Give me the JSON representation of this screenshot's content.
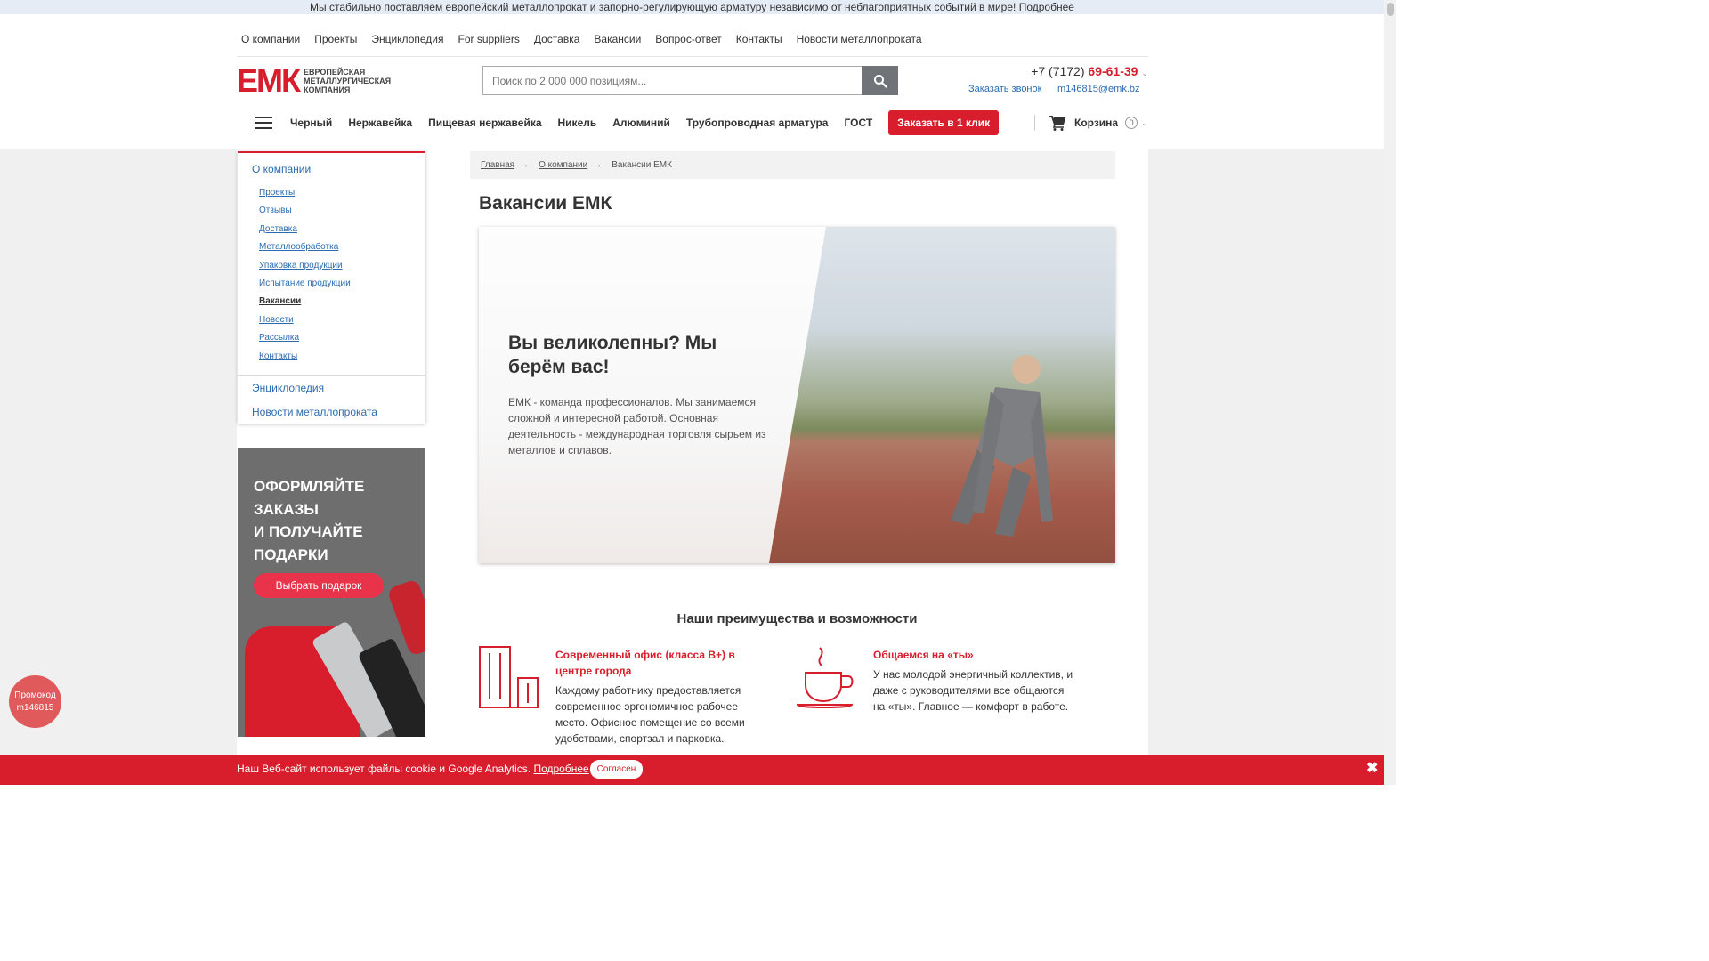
{
  "topbar": {
    "text": "Мы стабильно поставляем европейский металлопрокат и запорно-регулирующую арматуру независимо от неблагоприятных событий в мире!",
    "link": "Подробнее"
  },
  "topnav": [
    "О компании",
    "Проекты",
    "Энциклопедия",
    "For suppliers",
    "Доставка",
    "Вакансии",
    "Вопрос-ответ",
    "Контакты",
    "Новости металлопроката"
  ],
  "logo": {
    "mark": "ЕМК",
    "line1": "Европейская",
    "line2": "металлургическая",
    "line3": "компания"
  },
  "search": {
    "placeholder": "Поиск по 2 000 000 позициям..."
  },
  "contacts": {
    "phone_prefix": "+7 (7172) ",
    "phone_main": "69-61-39",
    "callback": "Заказать звонок",
    "email": "m146815@emk.bz"
  },
  "catnav": {
    "items": [
      "Черный",
      "Нержавейка",
      "Пищевая нержавейка",
      "Никель",
      "Алюминий",
      "Трубопроводная арматура",
      "ГОСТ"
    ],
    "oneclick": "Заказать в 1 клик",
    "cart_label": "Корзина",
    "cart_count": "0"
  },
  "sidebar": {
    "head": "О компании",
    "items": [
      "Проекты",
      "Отзывы",
      "Доставка",
      "Металлообработка",
      "Упаковка продукции",
      "Испытание продукции",
      "Вакансии",
      "Новости",
      "Рассылка",
      "Контакты"
    ],
    "active": "Вакансии",
    "sections": [
      "Энциклопедия",
      "Новости металлопроката"
    ]
  },
  "promo": {
    "line1": "ОФОРМЛЯЙТЕ",
    "line2": "ЗАКАЗЫ",
    "line3": "И ПОЛУЧАЙТЕ",
    "line4": "ПОДАРКИ",
    "button": "Выбрать подарок"
  },
  "breadcrumbs": [
    "Главная",
    "О компании",
    "Вакансии ЕМК"
  ],
  "page_title": "Вакансии ЕМК",
  "hero": {
    "title": "Вы великолепны? Мы берём вас!",
    "text": "ЕМК - команда профессионалов. Мы занимаемся сложной и интересной работой. Основная деятельность - международная торговля сырьем из металлов и сплавов."
  },
  "advantages": {
    "title": "Наши преимущества и возможности",
    "items": [
      {
        "title": "Современный офис (класса В+) в центре города",
        "text": "Каждому работнику предоставляется современное эргономичное рабочее место. Офисное помещение со всеми удобствами, спортзал и парковка.",
        "icon": "office-building-icon"
      },
      {
        "title": "Общаемся на «ты»",
        "text": "У нас молодой энергичный коллектив, и даже с руководителями все общаются на «ты». Главное — комфорт в работе.",
        "icon": "coffee-cup-icon"
      }
    ]
  },
  "promo_code": {
    "line1": "Промокод",
    "line2": "m146815"
  },
  "cookie": {
    "text": "Наш Веб-сайт использует файлы cookie и Google Analytics.",
    "link": "Подробнее",
    "agree": "Согласен"
  },
  "colors": {
    "accent": "#d81e2c",
    "link": "#2b6cb0"
  }
}
